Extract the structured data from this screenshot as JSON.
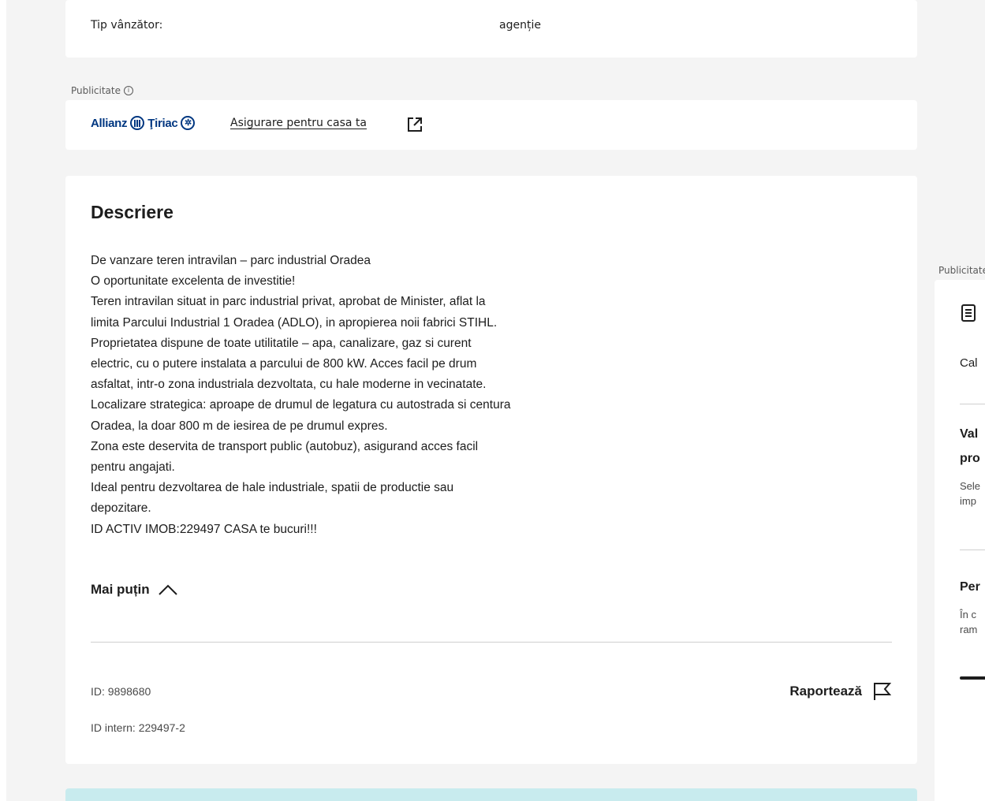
{
  "seller": {
    "label": "Tip vânzător:",
    "value": "agenție"
  },
  "ads": {
    "label": "Publicitate",
    "brand_left": "Allianz",
    "brand_right": "Ţiriac",
    "link_text": "Asigurare pentru casa ta"
  },
  "description": {
    "title": "Descriere",
    "lines": [
      "De vanzare teren intravilan – parc industrial Oradea",
      "O oportunitate excelenta de investitie!",
      "Teren intravilan situat in parc industrial privat, aprobat de Minister, aflat la",
      "limita Parcului Industrial 1 Oradea (ADLO), in apropierea noii fabrici STIHL.",
      "Proprietatea dispune de toate utilitatile – apa, canalizare, gaz si curent",
      "electric, cu o putere instalata a parcului de 800 kW. Acces facil pe drum",
      "asfaltat, intr-o zona industriala dezvoltata, cu hale moderne in vecinatate.",
      "Localizare strategica: aproape de drumul de legatura cu autostrada si centura",
      "Oradea, la doar 800 m de iesirea de pe drumul expres.",
      "Zona este deservita de transport public (autobuz), asigurand acces facil",
      "pentru angajati.",
      "Ideal pentru dezvoltarea de hale industriale, spatii de productie sau",
      "depozitare.",
      "ID ACTIV IMOB:229497 CASA te bucuri!!!"
    ],
    "less_label": "Mai puțin",
    "listing_id": "ID: 9898680",
    "internal_id": "ID intern: 229497-2",
    "report_label": "Raportează"
  },
  "sidebar": {
    "ad_label": "Publicitate",
    "cal": "Cal",
    "val": "Val",
    "pro": "pro",
    "sele": "Sele",
    "imp": "imp",
    "per": "Per",
    "inc": "În c",
    "ram": "ram"
  },
  "colors": {
    "page_bg": "#f4f4f4",
    "card_bg": "#ffffff",
    "brand_blue": "#003781",
    "teal_banner": "#c8ebee",
    "text": "#1d1d1d"
  }
}
